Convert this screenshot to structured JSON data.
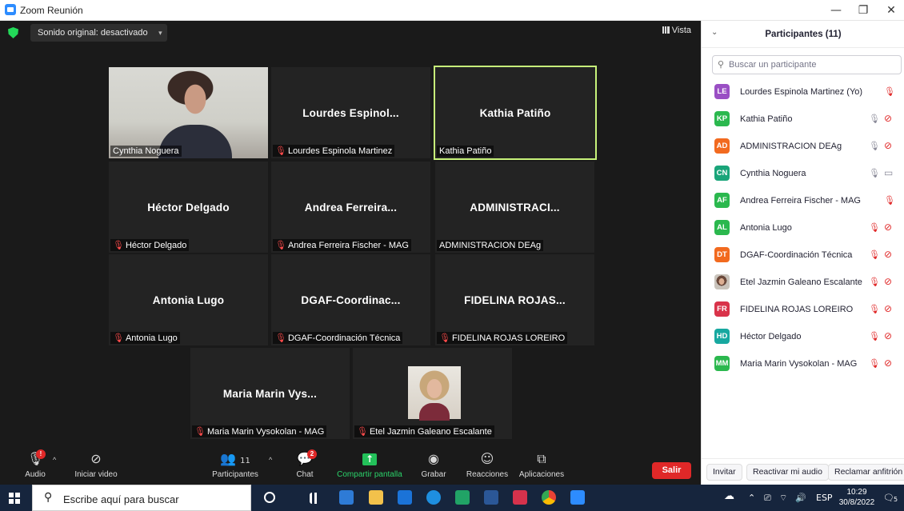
{
  "window": {
    "title": "Zoom Reunión",
    "minimize": "—",
    "restore": "❐",
    "close": "✕"
  },
  "topbar": {
    "sound_label": "Sonido original: desactivado",
    "sound_caret": "▾",
    "view_label": "Vista"
  },
  "tiles": [
    {
      "display": "",
      "label": "Cynthia Noguera",
      "muted": false,
      "video": true,
      "active": false
    },
    {
      "display": "Lourdes  Espinol...",
      "label": "Lourdes  Espinola Martinez",
      "muted": true,
      "video": false,
      "active": false
    },
    {
      "display": "Kathia Patiño",
      "label": "Kathia Patiño",
      "muted": false,
      "video": false,
      "active": true
    },
    {
      "display": "Héctor Delgado",
      "label": "Héctor Delgado",
      "muted": true,
      "video": false,
      "active": false
    },
    {
      "display": "Andrea  Ferreira...",
      "label": "Andrea Ferreira Fischer - MAG",
      "muted": true,
      "video": false,
      "active": false
    },
    {
      "display": "ADMINISTRACI...",
      "label": "ADMINISTRACION DEAg",
      "muted": false,
      "video": false,
      "active": false
    },
    {
      "display": "Antonia Lugo",
      "label": "Antonia Lugo",
      "muted": true,
      "video": false,
      "active": false
    },
    {
      "display": "DGAF-Coordinac...",
      "label": "DGAF-Coordinación Técnica",
      "muted": true,
      "video": false,
      "active": false
    },
    {
      "display": "FIDELINA  ROJAS...",
      "label": "FIDELINA ROJAS LOREIRO",
      "muted": true,
      "video": false,
      "active": false
    },
    {
      "display": "Maria  Marin  Vys...",
      "label": "Maria Marin Vysokolan - MAG",
      "muted": true,
      "video": false,
      "active": false
    },
    {
      "display": "",
      "label": "Etel Jazmin Galeano Escalante",
      "muted": true,
      "video": true,
      "active": false
    }
  ],
  "toolbar": {
    "audio": "Audio",
    "audio_badge": "!",
    "video": "Iniciar video",
    "participants": "Participantes",
    "participants_count": "11",
    "chat": "Chat",
    "chat_badge": "2",
    "share": "Compartir pantalla",
    "record": "Grabar",
    "reactions": "Reacciones",
    "apps": "Aplicaciones",
    "leave": "Salir"
  },
  "panel": {
    "title": "Participantes (11)",
    "search_placeholder": "Buscar un participante",
    "participants": [
      {
        "initials": "LE",
        "color": "#9a4fc4",
        "name": "Lourdes  Espinola Martinez (Yo)",
        "mic": "off",
        "video": "none"
      },
      {
        "initials": "KP",
        "color": "#2bb84e",
        "name": "Kathia Patiño",
        "mic": "on",
        "video": "off"
      },
      {
        "initials": "AD",
        "color": "#f26a1f",
        "name": "ADMINISTRACION DEAg",
        "mic": "on",
        "video": "off"
      },
      {
        "initials": "CN",
        "color": "#1aa57a",
        "name": "Cynthia Noguera",
        "mic": "on",
        "video": "on"
      },
      {
        "initials": "AF",
        "color": "#2bb84e",
        "name": "Andrea Ferreira Fischer - MAG",
        "mic": "off",
        "video": "none"
      },
      {
        "initials": "AL",
        "color": "#2bb84e",
        "name": "Antonia Lugo",
        "mic": "off",
        "video": "off"
      },
      {
        "initials": "DT",
        "color": "#f26a1f",
        "name": "DGAF-Coordinación Técnica",
        "mic": "off",
        "video": "off"
      },
      {
        "initials": "",
        "color": "",
        "name": "Etel Jazmin Galeano Escalante",
        "mic": "off",
        "video": "off",
        "photo": true
      },
      {
        "initials": "FR",
        "color": "#d9334a",
        "name": "FIDELINA ROJAS LOREIRO",
        "mic": "off",
        "video": "off"
      },
      {
        "initials": "HD",
        "color": "#17a8a0",
        "name": "Héctor Delgado",
        "mic": "off",
        "video": "off"
      },
      {
        "initials": "MM",
        "color": "#2bb84e",
        "name": "Maria Marin Vysokolan - MAG",
        "mic": "off",
        "video": "off"
      }
    ],
    "invite": "Invitar",
    "unmute": "Reactivar mi audio",
    "claim_host": "Reclamar anfitrión"
  },
  "taskbar": {
    "search_placeholder": "Escribe aquí para buscar",
    "lang": "ESP",
    "time": "10:29",
    "date": "30/8/2022",
    "notif": "5"
  }
}
